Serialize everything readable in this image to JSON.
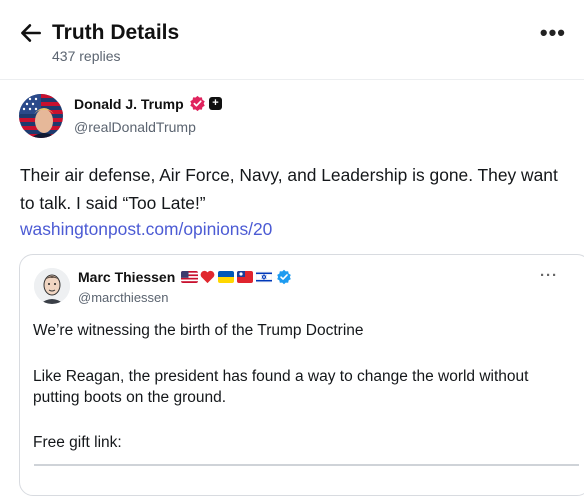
{
  "header": {
    "title": "Truth Details",
    "replies": "437 replies"
  },
  "post": {
    "author_name": "Donald J. Trump",
    "author_handle": "@realDonaldTrump",
    "plus_badge": "+",
    "text": "Their air defense, Air Force, Navy, and Leadership is gone. They want to talk. I said “Too Late!”",
    "link": "washingtonpost.com/opinions/20"
  },
  "quote": {
    "author_name": "Marc Thiessen",
    "author_handle": "@marcthiessen",
    "flags": [
      "us-flag",
      "red-heart",
      "ukraine-flag",
      "taiwan-flag",
      "israel-flag"
    ],
    "line1": "We’re witnessing the birth of the Trump Doctrine",
    "line2a": "Like Reagan, the president has found a way to change the world without",
    "line2b": "putting boots on the ground.",
    "line3": "Free gift link:"
  },
  "colors": {
    "link": "#4c5bd4",
    "verified_pink": "#e0245e",
    "verified_blue": "#1d9bf0",
    "muted": "#5b6470"
  }
}
